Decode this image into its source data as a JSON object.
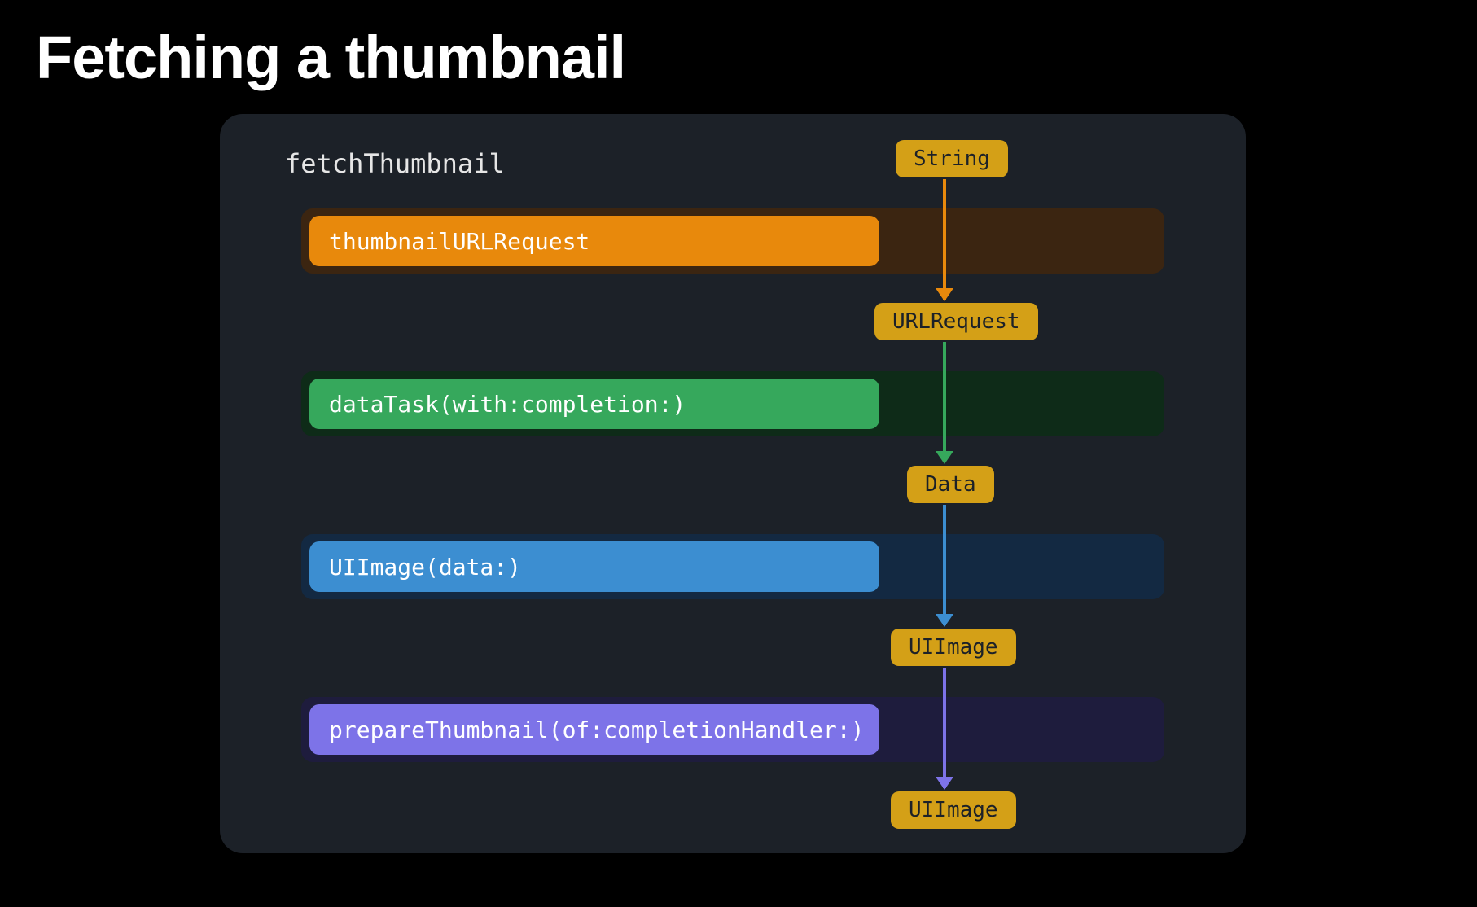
{
  "title": "Fetching a thumbnail",
  "panel": {
    "fn_name": "fetchThumbnail",
    "types": {
      "t0": "String",
      "t1": "URLRequest",
      "t2": "Data",
      "t3": "UIImage",
      "t4": "UIImage"
    },
    "steps": {
      "s0": {
        "label": "thumbnailURLRequest",
        "bg": "#3b2511",
        "fg": "#e8890c",
        "arrow": "#e8890c"
      },
      "s1": {
        "label": "dataTask(with:completion:)",
        "bg": "#0e2b18",
        "fg": "#36a85c",
        "arrow": "#36a85c"
      },
      "s2": {
        "label": "UIImage(data:)",
        "bg": "#132942",
        "fg": "#3c8ed1",
        "arrow": "#3c8ed1"
      },
      "s3": {
        "label": "prepareThumbnail(of:completionHandler:)",
        "bg": "#1e1c3d",
        "fg": "#7d73e8",
        "arrow": "#7d73e8"
      }
    }
  },
  "colors": {
    "type_box": "#d4a017",
    "panel": "#1c2128"
  }
}
